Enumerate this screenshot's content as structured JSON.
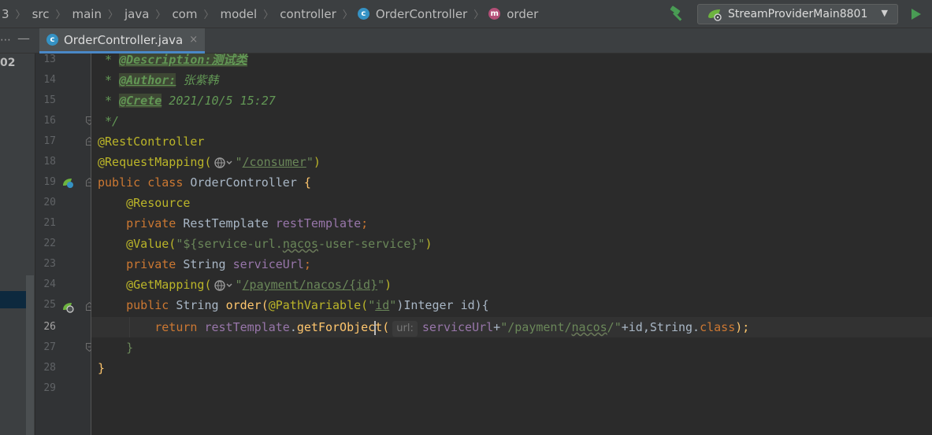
{
  "breadcrumb": {
    "items": [
      "3",
      "src",
      "main",
      "java",
      "com",
      "model",
      "controller",
      "OrderController",
      "order"
    ]
  },
  "run_config": {
    "name": "StreamProviderMain8801"
  },
  "left_strip": {
    "text": "02"
  },
  "tabs": [
    {
      "label": "OrderController.java",
      "close": "×"
    }
  ],
  "gutter": {
    "line_numbers": [
      "13",
      "14",
      "15",
      "16",
      "17",
      "18",
      "19",
      "20",
      "21",
      "22",
      "23",
      "24",
      "25",
      "26",
      "27",
      "28",
      "29"
    ],
    "current_line": "26"
  },
  "code": {
    "l13_star": " * ",
    "l13_tag": "@Description:测试类",
    "l14_star": " * ",
    "l14_tag": "@Author:",
    "l14_rest": " 张紫韩",
    "l15_star": " * ",
    "l15_tag": "@Crete",
    "l15_rest": " 2021/10/5 15:27",
    "l16": " */",
    "l17": "@RestController",
    "l18_ann": "@RequestMapping(",
    "l18_q1": "\"",
    "l18_path": "/consumer",
    "l18_q2": "\"",
    "l18_close": ")",
    "l19_kw": "public class ",
    "l19_name": "OrderController ",
    "l19_brace": "{",
    "l20": "@Resource",
    "l21_kw": "private ",
    "l21_type": "RestTemplate ",
    "l21_field": "restTemplate",
    "l21_semi": ";",
    "l22_ann": "@Value(",
    "l22_s1": "\"${service-url.",
    "l22_s2": "nacos",
    "l22_s3": "-user-service}\"",
    "l22_close": ")",
    "l23_kw": "private ",
    "l23_type": "String ",
    "l23_field": "serviceUrl",
    "l23_semi": ";",
    "l24_ann": "@GetMapping(",
    "l24_q1": "\"",
    "l24_path": "/payment/nacos/{id}",
    "l24_q2": "\"",
    "l24_close": ")",
    "l25_kw": "public ",
    "l25_type": "String ",
    "l25_method": "order",
    "l25_open": "(",
    "l25_ann": "@PathVariable(",
    "l25_s1": "\"",
    "l25_id": "id",
    "l25_s2": "\"",
    "l25_rest": ")Integer id){",
    "l26_kw": "return ",
    "l26_field": "restTemplate",
    "l26_dot": ".",
    "l26_m1": "getForObjec",
    "l26_m2": "t",
    "l26_open": "(",
    "l26_hint": "url:",
    "l26_field2": "serviceUrl",
    "l26_plus": "+",
    "l26_s1": "\"/payment/",
    "l26_s2": "nacos",
    "l26_s3": "/\"",
    "l26_rest1": "+id,String.",
    "l26_kw2": "class",
    "l26_rest2": ");",
    "l27": "}",
    "l28": "}"
  },
  "colors": {
    "background": "#2b2b2b",
    "comment": "#629755",
    "annotation": "#bbb529",
    "keyword": "#cc7832",
    "string": "#6a8759",
    "field": "#9876aa",
    "method": "#ffc66d",
    "class_icon": "#3592c4",
    "method_icon": "#b34f77",
    "run_green": "#499c54"
  }
}
